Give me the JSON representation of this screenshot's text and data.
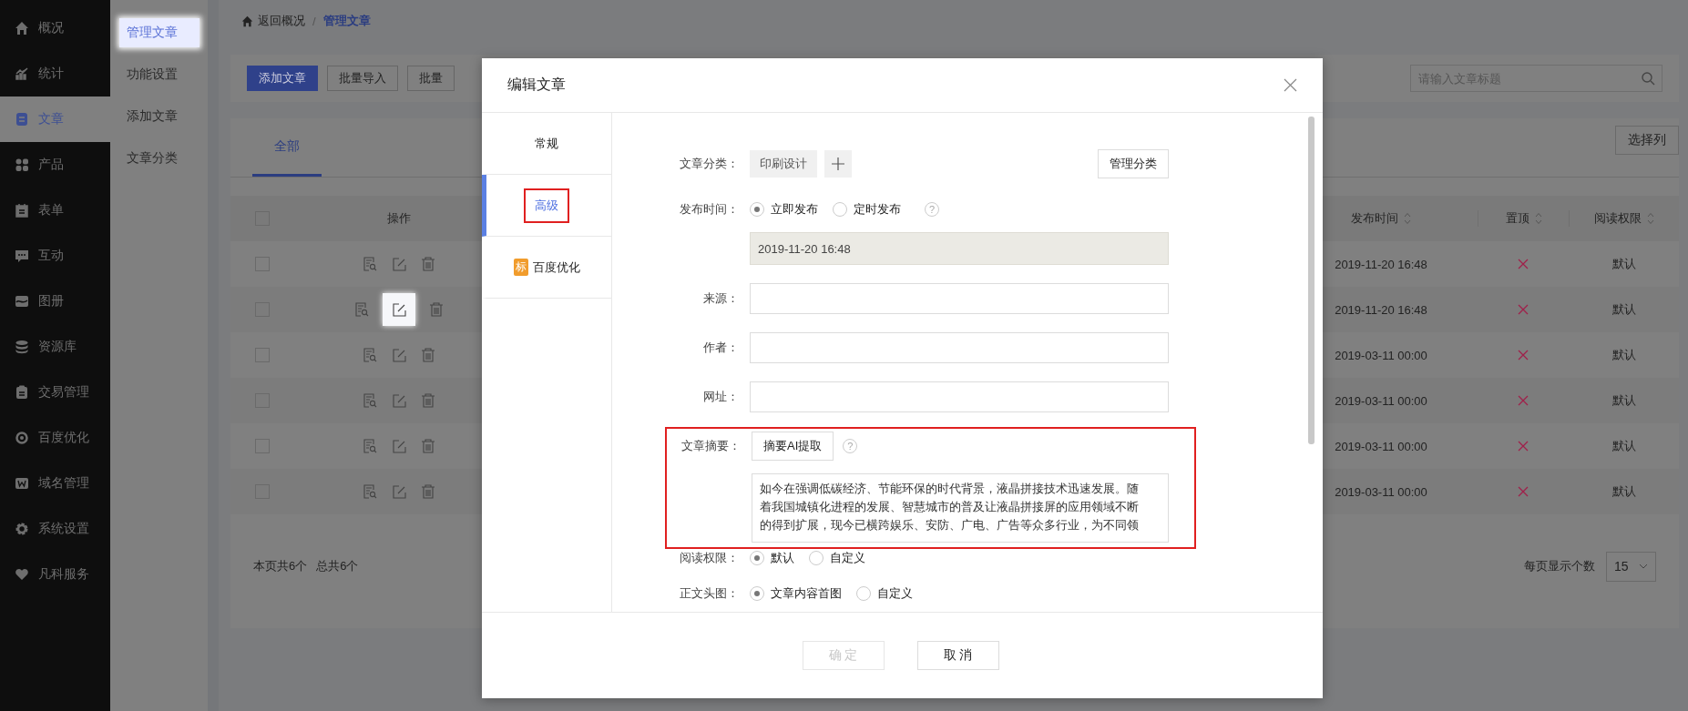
{
  "nav": [
    {
      "label": "概况",
      "selected": false
    },
    {
      "label": "统计",
      "selected": false
    },
    {
      "label": "文章",
      "selected": true
    },
    {
      "label": "产品",
      "selected": false
    },
    {
      "label": "表单",
      "selected": false
    },
    {
      "label": "互动",
      "selected": false
    },
    {
      "label": "图册",
      "selected": false
    },
    {
      "label": "资源库",
      "selected": false
    },
    {
      "label": "交易管理",
      "selected": false
    },
    {
      "label": "百度优化",
      "selected": false
    },
    {
      "label": "域名管理",
      "selected": false
    },
    {
      "label": "系统设置",
      "selected": false
    },
    {
      "label": "凡科服务",
      "selected": false
    }
  ],
  "submenu": [
    {
      "label": "管理文章",
      "selected": true
    },
    {
      "label": "功能设置",
      "selected": false
    },
    {
      "label": "添加文章",
      "selected": false
    },
    {
      "label": "文章分类",
      "selected": false
    }
  ],
  "breadcrumb": {
    "back": "返回概况",
    "separator": "/",
    "current": "管理文章"
  },
  "toolbar": {
    "buttons": [
      {
        "label": "添加文章",
        "primary": true
      },
      {
        "label": "批量导入",
        "primary": false
      },
      {
        "label": "批量",
        "primary": false
      }
    ],
    "search": {
      "placeholder": "请输入文章标题"
    }
  },
  "table": {
    "tabs": [
      {
        "label": "全部",
        "selected": true
      }
    ],
    "column_chooser": "选择列",
    "header_checked": false,
    "columns": [
      {
        "label": "操作",
        "sortable": false
      },
      {
        "label": "发布时间",
        "sortable": true
      },
      {
        "label": "置顶",
        "sortable": true
      },
      {
        "label": "阅读权限",
        "sortable": true
      }
    ],
    "rows": [
      {
        "checked": false,
        "edit_highlighted": false,
        "time": "2019-11-20 16:48",
        "pinned": false,
        "permission": "默认"
      },
      {
        "checked": false,
        "edit_highlighted": true,
        "time": "2019-11-20 16:48",
        "pinned": false,
        "permission": "默认"
      },
      {
        "checked": false,
        "edit_highlighted": false,
        "time": "2019-03-11 00:00",
        "pinned": false,
        "permission": "默认"
      },
      {
        "checked": false,
        "edit_highlighted": false,
        "time": "2019-03-11 00:00",
        "pinned": false,
        "permission": "默认"
      },
      {
        "checked": false,
        "edit_highlighted": false,
        "time": "2019-03-11 00:00",
        "pinned": false,
        "permission": "默认"
      },
      {
        "checked": false,
        "edit_highlighted": false,
        "time": "2019-03-11 00:00",
        "pinned": false,
        "permission": "默认"
      }
    ],
    "footer": {
      "page_count": "本页共6个",
      "total_count": "总共6个",
      "page_size_label": "每页显示个数",
      "page_size": "15"
    }
  },
  "modal": {
    "title": "编辑文章",
    "tabs": [
      {
        "label": "常规",
        "selected": false,
        "annotated": false
      },
      {
        "label": "高级",
        "selected": true,
        "annotated": true
      },
      {
        "label": "百度优化",
        "badge": "标",
        "selected": false,
        "annotated": false
      }
    ],
    "fields": [
      {
        "kind": "category",
        "label": "文章分类：",
        "tag": "印刷设计",
        "manage_button": "管理分类"
      },
      {
        "kind": "radio",
        "label": "发布时间：",
        "options": [
          {
            "label": "立即发布",
            "selected": true
          },
          {
            "label": "定时发布",
            "selected": false
          }
        ],
        "help": "?"
      },
      {
        "kind": "readonly",
        "value": "2019-11-20 16:48"
      },
      {
        "kind": "text",
        "label": "来源："
      },
      {
        "kind": "text",
        "label": "作者："
      },
      {
        "kind": "text",
        "label": "网址："
      },
      {
        "kind": "summary",
        "label": "文章摘要：",
        "button": "摘要AI提取",
        "help": "?",
        "annotated": true,
        "value": "如今在强调低碳经济、节能环保的时代背景，液晶拼接技术迅速发展。随着我国城镇化进程的发展、智慧城市的普及让液晶拼接屏的应用领域不断的得到扩展，现今已横跨娱乐、安防、广电、广告等众多行业，为不同领"
      },
      {
        "kind": "radio",
        "label": "阅读权限：",
        "options": [
          {
            "label": "默认",
            "selected": true
          },
          {
            "label": "自定义",
            "selected": false
          }
        ]
      },
      {
        "kind": "radio",
        "label": "正文头图：",
        "options": [
          {
            "label": "文章内容首图",
            "selected": true
          },
          {
            "label": "自定义",
            "selected": false
          }
        ]
      }
    ],
    "buttons": [
      {
        "label": "确 定",
        "disabled": true
      },
      {
        "label": "取 消",
        "disabled": false
      }
    ]
  }
}
